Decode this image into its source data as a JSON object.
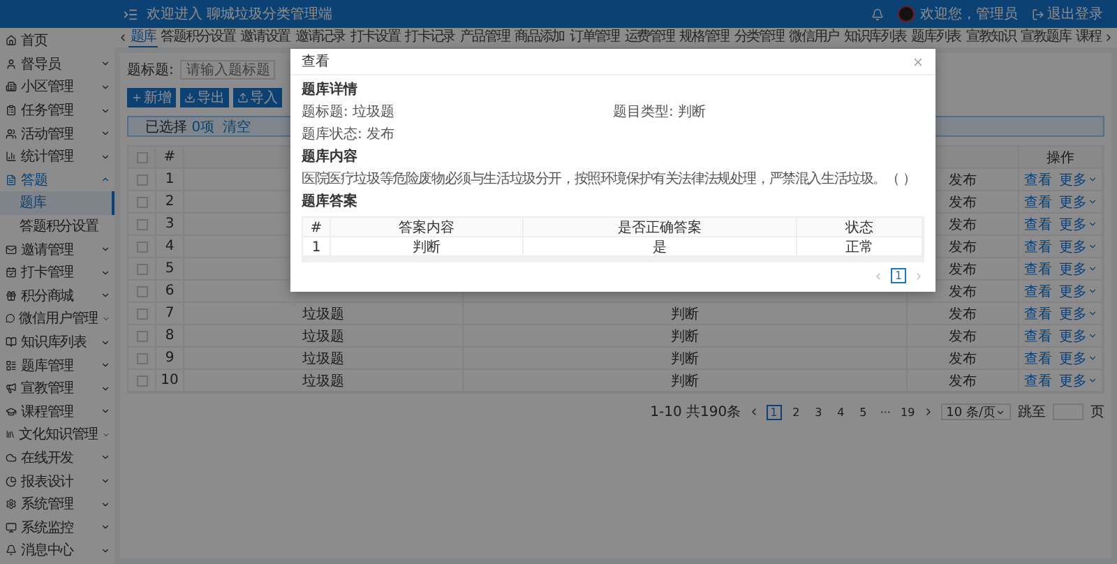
{
  "header": {
    "title": "欢迎进入 聊城垃圾分类管理端",
    "user": "欢迎您，管理员",
    "logout": "退出登录"
  },
  "sidebar": {
    "items": [
      {
        "label": "首页",
        "selected": false
      },
      {
        "label": "督导员",
        "selected": false,
        "expanded": false
      },
      {
        "label": "小区管理",
        "selected": false,
        "expanded": false
      },
      {
        "label": "任务管理",
        "selected": false,
        "expanded": false
      },
      {
        "label": "活动管理",
        "selected": false,
        "expanded": false
      },
      {
        "label": "统计管理",
        "selected": false,
        "expanded": false
      },
      {
        "label": "答题",
        "selected": true,
        "expanded": true,
        "children": [
          {
            "label": "题库",
            "selected": true
          },
          {
            "label": "答题积分设置",
            "selected": false
          }
        ]
      },
      {
        "label": "邀请管理",
        "selected": false,
        "expanded": false
      },
      {
        "label": "打卡管理",
        "selected": false,
        "expanded": false
      },
      {
        "label": "积分商城",
        "selected": false,
        "expanded": false
      },
      {
        "label": "微信用户管理",
        "selected": false,
        "expanded": false
      },
      {
        "label": "知识库列表",
        "selected": false,
        "expanded": false
      },
      {
        "label": "题库管理",
        "selected": false,
        "expanded": false
      },
      {
        "label": "宣教管理",
        "selected": false,
        "expanded": false
      },
      {
        "label": "课程管理",
        "selected": false,
        "expanded": false
      },
      {
        "label": "文化知识管理",
        "selected": false,
        "expanded": false
      },
      {
        "label": "在线开发",
        "selected": false,
        "expanded": false
      },
      {
        "label": "报表设计",
        "selected": false,
        "expanded": false
      },
      {
        "label": "系统管理",
        "selected": false,
        "expanded": false
      },
      {
        "label": "系统监控",
        "selected": false,
        "expanded": false
      },
      {
        "label": "消息中心",
        "selected": false,
        "expanded": false
      }
    ]
  },
  "tabs": [
    {
      "label": "题库",
      "selected": true
    },
    {
      "label": "答题积分设置",
      "selected": false
    },
    {
      "label": "邀请设置",
      "selected": false
    },
    {
      "label": "邀请记录",
      "selected": false
    },
    {
      "label": "打卡设置",
      "selected": false
    },
    {
      "label": "打卡记录",
      "selected": false
    },
    {
      "label": "产品管理",
      "selected": false
    },
    {
      "label": "商品添加",
      "selected": false
    },
    {
      "label": "订单管理",
      "selected": false
    },
    {
      "label": "运费管理",
      "selected": false
    },
    {
      "label": "规格管理",
      "selected": false
    },
    {
      "label": "分类管理",
      "selected": false
    },
    {
      "label": "微信用户",
      "selected": false
    },
    {
      "label": "知识库列表",
      "selected": false
    },
    {
      "label": "题库列表",
      "selected": false
    },
    {
      "label": "宣教知识",
      "selected": false
    },
    {
      "label": "宣教题库",
      "selected": false
    },
    {
      "label": "课程",
      "selected": false
    }
  ],
  "search": {
    "label": "题标题:",
    "placeholder": "请输入题标题"
  },
  "actions": [
    "新增",
    "导出",
    "导入"
  ],
  "selection": {
    "label": "已选择",
    "count": "0项",
    "clear": "清空"
  },
  "table": {
    "all_checked": false,
    "columns": {
      "index": "#",
      "actions": "操作"
    },
    "rows": [
      {
        "no": "1",
        "checked": false,
        "status": "发布",
        "view": "查看",
        "more": "更多"
      },
      {
        "no": "2",
        "checked": false,
        "status": "发布",
        "view": "查看",
        "more": "更多"
      },
      {
        "no": "3",
        "checked": false,
        "status": "发布",
        "view": "查看",
        "more": "更多"
      },
      {
        "no": "4",
        "checked": false,
        "status": "发布",
        "view": "查看",
        "more": "更多"
      },
      {
        "no": "5",
        "checked": false,
        "status": "发布",
        "view": "查看",
        "more": "更多"
      },
      {
        "no": "6",
        "checked": false,
        "status": "发布",
        "view": "查看",
        "more": "更多"
      },
      {
        "no": "7",
        "checked": false,
        "title": "垃圾题",
        "type": "判断",
        "status": "发布",
        "view": "查看",
        "more": "更多"
      },
      {
        "no": "8",
        "checked": false,
        "title": "垃圾题",
        "type": "判断",
        "status": "发布",
        "view": "查看",
        "more": "更多"
      },
      {
        "no": "9",
        "checked": false,
        "title": "垃圾题",
        "type": "判断",
        "status": "发布",
        "view": "查看",
        "more": "更多"
      },
      {
        "no": "10",
        "checked": false,
        "title": "垃圾题",
        "type": "判断",
        "status": "发布",
        "view": "查看",
        "more": "更多"
      }
    ]
  },
  "pagination": {
    "total": "1-10 共190条",
    "pages": [
      {
        "label": "1",
        "selected": true
      },
      {
        "label": "2",
        "selected": false
      },
      {
        "label": "3",
        "selected": false
      },
      {
        "label": "4",
        "selected": false
      },
      {
        "label": "5",
        "selected": false
      },
      {
        "label": "···",
        "selected": false
      },
      {
        "label": "19",
        "selected": false
      }
    ],
    "size": "10 条/页",
    "jump": "跳至",
    "page": "页"
  },
  "modal": {
    "title": "查看",
    "detail_heading": "题库详情",
    "fields": [
      {
        "label": "题标题:",
        "value": "垃圾题"
      },
      {
        "label": "题目类型:",
        "value": "判断"
      },
      {
        "label": "题库状态:",
        "value": "发布"
      }
    ],
    "content_heading": "题库内容",
    "content": "医院医疗垃圾等危险废物必须与生活垃圾分开，按照环境保护有关法律法规处理，严禁混入生活垃圾。（ ）",
    "answer_heading": "题库答案",
    "answers": {
      "columns": [
        "#",
        "答案内容",
        "是否正确答案",
        "状态"
      ],
      "rows": [
        [
          "1",
          "判断",
          "是",
          "正常"
        ]
      ]
    },
    "pages": [
      {
        "label": "1",
        "selected": true
      }
    ]
  }
}
